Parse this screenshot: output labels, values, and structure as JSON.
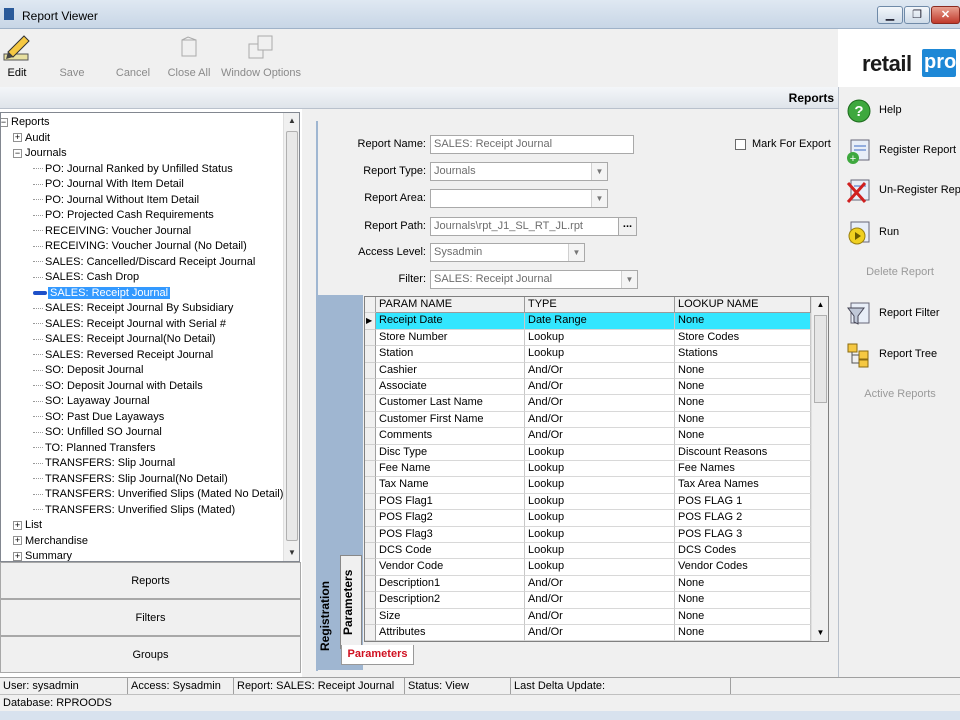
{
  "window": {
    "title": "Report Viewer"
  },
  "toolbar": {
    "edit": "Edit",
    "save": "Save",
    "cancel": "Cancel",
    "close_all": "Close All",
    "window_options": "Window Options"
  },
  "logo": {
    "text": "retail",
    "box": "pro"
  },
  "header": {
    "reports_label": "Reports"
  },
  "tree": {
    "rows": [
      {
        "text": "Reports",
        "expander": "⊟",
        "level": 0
      },
      {
        "text": "Audit",
        "expander": "⊞",
        "level": 1
      },
      {
        "text": "Journals",
        "expander": "⊟",
        "level": 1
      },
      {
        "text": "PO: Journal Ranked by Unfilled Status",
        "level": 2
      },
      {
        "text": "PO: Journal With Item Detail",
        "level": 2
      },
      {
        "text": "PO: Journal Without Item Detail",
        "level": 2
      },
      {
        "text": "PO: Projected Cash Requirements",
        "level": 2
      },
      {
        "text": "RECEIVING: Voucher Journal",
        "level": 2
      },
      {
        "text": "RECEIVING: Voucher Journal (No Detail)",
        "level": 2
      },
      {
        "text": "SALES: Cancelled/Discard Receipt Journal",
        "level": 2
      },
      {
        "text": "SALES: Cash Drop",
        "level": 2
      },
      {
        "text": "SALES: Receipt Journal",
        "level": 2,
        "selected": true
      },
      {
        "text": "SALES: Receipt Journal By Subsidiary",
        "level": 2
      },
      {
        "text": "SALES: Receipt Journal with Serial #",
        "level": 2
      },
      {
        "text": "SALES: Receipt Journal(No Detail)",
        "level": 2
      },
      {
        "text": "SALES: Reversed Receipt Journal",
        "level": 2
      },
      {
        "text": "SO: Deposit Journal",
        "level": 2
      },
      {
        "text": "SO: Deposit Journal with Details",
        "level": 2
      },
      {
        "text": "SO: Layaway Journal",
        "level": 2
      },
      {
        "text": "SO: Past Due Layaways",
        "level": 2
      },
      {
        "text": "SO: Unfilled SO Journal",
        "level": 2
      },
      {
        "text": "TO: Planned Transfers",
        "level": 2
      },
      {
        "text": "TRANSFERS: Slip Journal",
        "level": 2
      },
      {
        "text": "TRANSFERS: Slip Journal(No Detail)",
        "level": 2
      },
      {
        "text": "TRANSFERS: Unverified Slips (Mated No Detail)",
        "level": 2
      },
      {
        "text": "TRANSFERS: Unverified Slips (Mated)",
        "level": 2
      },
      {
        "text": "List",
        "expander": "⊞",
        "level": 1
      },
      {
        "text": "Merchandise",
        "expander": "⊞",
        "level": 1
      },
      {
        "text": "Summary",
        "expander": "⊞",
        "level": 1
      }
    ]
  },
  "nav": {
    "reports": "Reports",
    "filters": "Filters",
    "groups": "Groups"
  },
  "form": {
    "report_name_label": "Report Name:",
    "report_name_value": "SALES: Receipt Journal",
    "mark_export_label": "Mark For Export",
    "report_type_label": "Report Type:",
    "report_type_value": "Journals",
    "report_area_label": "Report Area:",
    "report_area_value": "",
    "report_path_label": "Report Path:",
    "report_path_value": "Journals\\rpt_J1_SL_RT_JL.rpt",
    "access_level_label": "Access Level:",
    "access_level_value": "Sysadmin",
    "filter_label": "Filter:",
    "filter_value": "SALES: Receipt Journal",
    "ellipsis": "..."
  },
  "tabs": {
    "registration": "Registration",
    "parameters_vertical": "Parameters",
    "parameters_bottom": "Parameters"
  },
  "grid": {
    "headers": [
      "PARAM NAME",
      "TYPE",
      "LOOKUP NAME"
    ],
    "rows": [
      [
        "Receipt Date",
        "Date Range",
        "None"
      ],
      [
        "Store Number",
        "Lookup",
        "Store Codes"
      ],
      [
        "Station",
        "Lookup",
        "Stations"
      ],
      [
        "Cashier",
        "And/Or",
        "None"
      ],
      [
        "Associate",
        "And/Or",
        "None"
      ],
      [
        "Customer Last Name",
        "And/Or",
        "None"
      ],
      [
        "Customer First Name",
        "And/Or",
        "None"
      ],
      [
        "Comments",
        "And/Or",
        "None"
      ],
      [
        "Disc Type",
        "Lookup",
        "Discount Reasons"
      ],
      [
        "Fee Name",
        "Lookup",
        "Fee Names"
      ],
      [
        "Tax Name",
        "Lookup",
        "Tax Area Names"
      ],
      [
        "POS Flag1",
        "Lookup",
        "POS FLAG 1"
      ],
      [
        "POS Flag2",
        "Lookup",
        "POS FLAG 2"
      ],
      [
        "POS Flag3",
        "Lookup",
        "POS FLAG 3"
      ],
      [
        "DCS Code",
        "Lookup",
        "DCS Codes"
      ],
      [
        "Vendor Code",
        "Lookup",
        "Vendor Codes"
      ],
      [
        "Description1",
        "And/Or",
        "None"
      ],
      [
        "Description2",
        "And/Or",
        "None"
      ],
      [
        "Size",
        "And/Or",
        "None"
      ],
      [
        "Attributes",
        "And/Or",
        "None"
      ]
    ]
  },
  "actions": {
    "help": "Help",
    "register": "Register Report",
    "unregister": "Un-Register Report",
    "run": "Run",
    "delete": "Delete Report",
    "filter": "Report Filter",
    "tree": "Report Tree",
    "active": "Active Reports"
  },
  "status": {
    "user": "User: sysadmin",
    "access": "Access: Sysadmin",
    "report": "Report: SALES: Receipt Journal",
    "status": "Status: View",
    "delta": "Last Delta Update:",
    "database": "Database: RPROODS"
  },
  "colors": {
    "selection": "#3399ff",
    "grid_highlight": "#33e6ff",
    "tab_accent": "#d01020",
    "panel_border": "#9fb6d1"
  }
}
